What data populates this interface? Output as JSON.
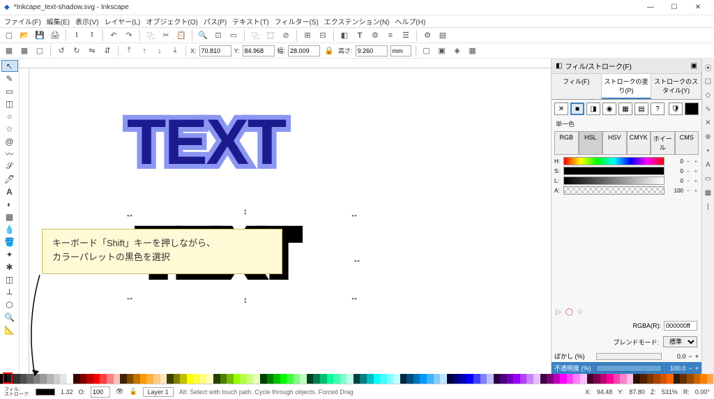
{
  "title": "*Inkcape_text-shadow.svg - Inkscape",
  "menu": [
    "ファイル(F)",
    "編集(E)",
    "表示(V)",
    "レイヤー(L)",
    "オブジェクト(O)",
    "パス(P)",
    "テキスト(T)",
    "フィルター(S)",
    "エクステンション(N)",
    "ヘルプ(H)"
  ],
  "coords": {
    "x_label": "X:",
    "x": "70.810",
    "y_label": "Y:",
    "y": "84.968",
    "w_label": "幅:",
    "w": "28.009",
    "h_label": "高さ:",
    "h": "9.260",
    "unit": "mm"
  },
  "canvas_text": "TEXT",
  "callout_line1": "キーボード「Shift」キーを押しながら、",
  "callout_line2": "カラーパレットの黒色を選択",
  "dialog": {
    "title": "フィル/ストローク(F)",
    "tabs": [
      "フィル(F)",
      "ストロークの塗り(P)",
      "ストロークのスタイル(Y)"
    ],
    "active_tab": 1,
    "flat_label": "単一色",
    "color_modes": [
      "RGB",
      "HSL",
      "HSV",
      "CMYK",
      "ホイール",
      "CMS"
    ],
    "active_mode": 1,
    "sliders": {
      "H": {
        "val": "0"
      },
      "S": {
        "val": "0"
      },
      "L": {
        "val": "0"
      },
      "A": {
        "val": "100"
      }
    },
    "rgba_label": "RGBA(R):",
    "rgba": "000000ff",
    "blend_label": "ブレンドモード:",
    "blend_value": "標準",
    "blur_label": "ぼかし (%)",
    "blur_val": "0.0",
    "opacity_label": "不透明度 (%)",
    "opacity_val": "100.0"
  },
  "status": {
    "fill_label": "フィル:",
    "stroke_label": "ストローク:",
    "stroke_val": "1.32",
    "opacity_label": "O:",
    "opacity": "100",
    "layer": "Layer 1",
    "hint": "Alt: Select with touch path. Cycle through objects. Forced Drag",
    "x_label": "X:",
    "x": "94.48",
    "y_label": "Y:",
    "y": "87.80",
    "z_label": "Z:",
    "z": "531%",
    "r_label": "R:",
    "r": "0.00°"
  },
  "palette_colors": [
    "#000000",
    "#1a1a1a",
    "#333333",
    "#4d4d4d",
    "#666666",
    "#808080",
    "#999999",
    "#b3b3b3",
    "#cccccc",
    "#e6e6e6",
    "#ffffff",
    "#400000",
    "#800000",
    "#bf0000",
    "#ff0000",
    "#ff4040",
    "#ff8080",
    "#ffbfbf",
    "#402600",
    "#804d00",
    "#bf7300",
    "#ff9900",
    "#ffb340",
    "#ffcc80",
    "#ffe6bf",
    "#404000",
    "#808000",
    "#bfbf00",
    "#ffff00",
    "#ffff40",
    "#ffff80",
    "#ffffbf",
    "#264000",
    "#4d8000",
    "#73bf00",
    "#99ff00",
    "#b3ff40",
    "#ccff80",
    "#e6ffbf",
    "#004000",
    "#008000",
    "#00bf00",
    "#00ff00",
    "#40ff40",
    "#80ff80",
    "#bfffbf",
    "#004026",
    "#00804d",
    "#00bf73",
    "#00ff99",
    "#40ffb3",
    "#80ffcc",
    "#bfffe6",
    "#004040",
    "#008080",
    "#00bfbf",
    "#00ffff",
    "#40ffff",
    "#80ffff",
    "#bfffff",
    "#002640",
    "#004d80",
    "#0073bf",
    "#0099ff",
    "#40b3ff",
    "#80ccff",
    "#bfe6ff",
    "#000040",
    "#000080",
    "#0000bf",
    "#0000ff",
    "#4040ff",
    "#8080ff",
    "#bfbfff",
    "#260040",
    "#4d0080",
    "#7300bf",
    "#9900ff",
    "#b340ff",
    "#cc80ff",
    "#e6bfff",
    "#400040",
    "#800080",
    "#bf00bf",
    "#ff00ff",
    "#ff40ff",
    "#ff80ff",
    "#ffbfff",
    "#400026",
    "#80004d",
    "#bf0073",
    "#ff0099",
    "#ff40b3",
    "#ff80cc",
    "#ffbfe6",
    "#2b1100",
    "#552200",
    "#803300",
    "#aa4400",
    "#d45500",
    "#ff6600",
    "#331a00",
    "#663300",
    "#994d00",
    "#cc6600",
    "#ff8000",
    "#ffa64d"
  ]
}
